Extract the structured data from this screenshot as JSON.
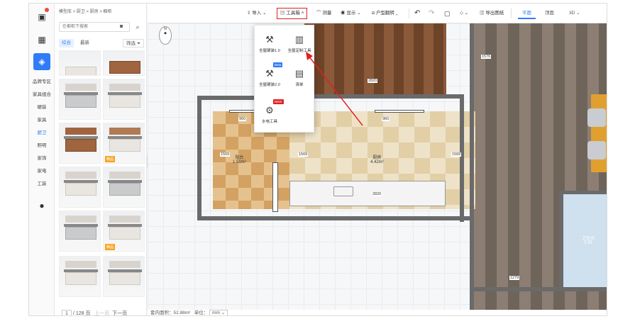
{
  "rail": {
    "categories": [
      "品牌专区",
      "家具组合",
      "硬装",
      "家具",
      "厨卫",
      "照明",
      "家饰",
      "家电",
      "工装"
    ],
    "selected_category": "厨卫"
  },
  "catalog": {
    "breadcrumb": "模型库 > 厨卫 > 厨房 > 橱柜",
    "search_placeholder": "在橱柜下搜索",
    "tabs": [
      "综合",
      "最新"
    ],
    "selected_tab": "综合",
    "filter_label": "筛选",
    "badge_label": "精品",
    "pagination": {
      "current": "1",
      "total_text": "/ 128 页",
      "prev": "上一页",
      "next": "下一页"
    }
  },
  "toolbar": {
    "import": "导入",
    "toolbox": "工具箱",
    "measure": "测量",
    "display": "显示",
    "flip": "户型翻转",
    "export": "导出图纸",
    "views": [
      "平面",
      "顶面",
      "3D"
    ],
    "selected_view": "平面"
  },
  "toolbox_menu": {
    "items": [
      {
        "label": "全屋硬装1.0",
        "icon": "hard-decor-icon",
        "tag": ""
      },
      {
        "label": "全屋定制工具",
        "icon": "custom-cabinet-icon",
        "tag": ""
      },
      {
        "label": "全屋硬装2.0",
        "icon": "hard-decor-v2-icon",
        "tag": "Beta"
      },
      {
        "label": "清单",
        "icon": "list-icon",
        "tag": ""
      },
      {
        "label": "水电工具",
        "icon": "plumbing-icon",
        "tag": "NEW"
      }
    ]
  },
  "floorplan": {
    "compass": "N",
    "rooms": [
      {
        "name": "阳台",
        "area": "1.51m²"
      },
      {
        "name": "厨房",
        "area": "4.42m²"
      },
      {
        "name": "卫生间",
        "area": "3.45"
      }
    ],
    "dimensions": [
      "960",
      "960",
      "1569",
      "1569",
      "1569",
      "2820",
      "2820",
      "1279",
      "1576"
    ]
  },
  "status": {
    "area_label": "套内面积：52.88m²",
    "unit_label": "单位：",
    "unit_value": "mm"
  },
  "colors": {
    "accent": "#2f7cf6",
    "highlight": "#e02020",
    "wall": "#6a6a6a"
  }
}
